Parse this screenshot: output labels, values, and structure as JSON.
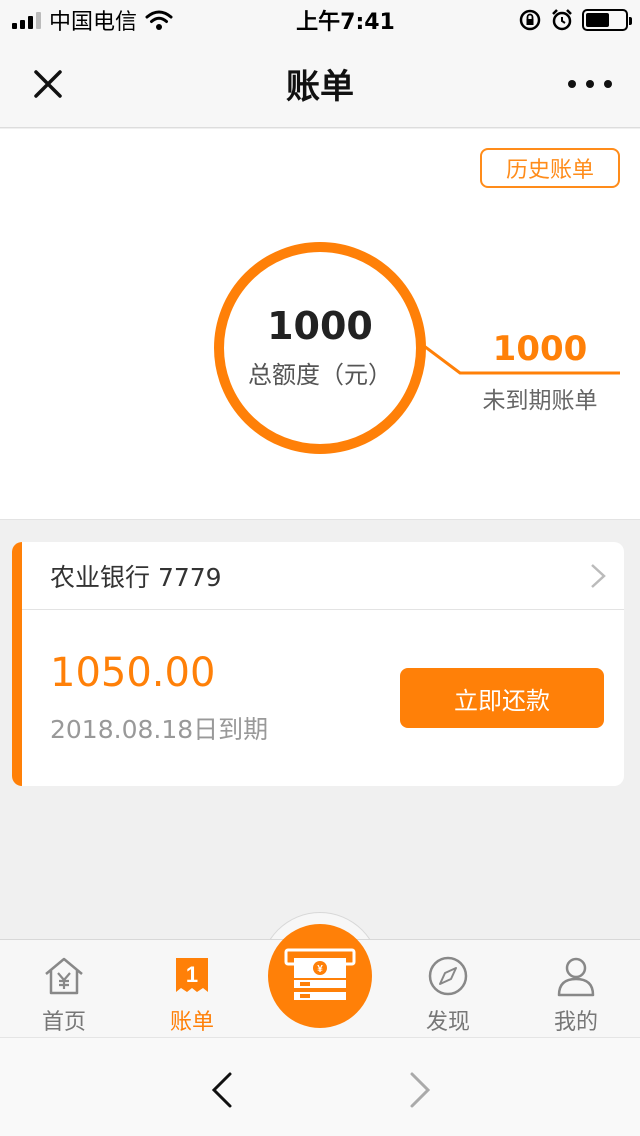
{
  "status_bar": {
    "carrier": "中国电信",
    "time": "上午7:41"
  },
  "nav": {
    "title": "账单"
  },
  "summary": {
    "history_button": "历史账单",
    "total_limit_value": "1000",
    "total_limit_label": "总额度（元）",
    "not_due_value": "1000",
    "not_due_label": "未到期账单"
  },
  "bill": {
    "bank": "农业银行 7779",
    "amount": "1050.00",
    "due_date": "2018.08.18日到期",
    "pay_button": "立即还款"
  },
  "tabs": [
    {
      "label": "首页",
      "icon": "home-yen-icon",
      "active": false
    },
    {
      "label": "账单",
      "icon": "bill-badge-icon",
      "badge": "1",
      "active": true
    },
    {
      "label": "",
      "icon": "cash-icon",
      "active": false
    },
    {
      "label": "发现",
      "icon": "compass-icon",
      "active": false
    },
    {
      "label": "我的",
      "icon": "user-icon",
      "active": false
    }
  ],
  "colors": {
    "accent": "#ff8008",
    "background": "#f0f0f0"
  }
}
